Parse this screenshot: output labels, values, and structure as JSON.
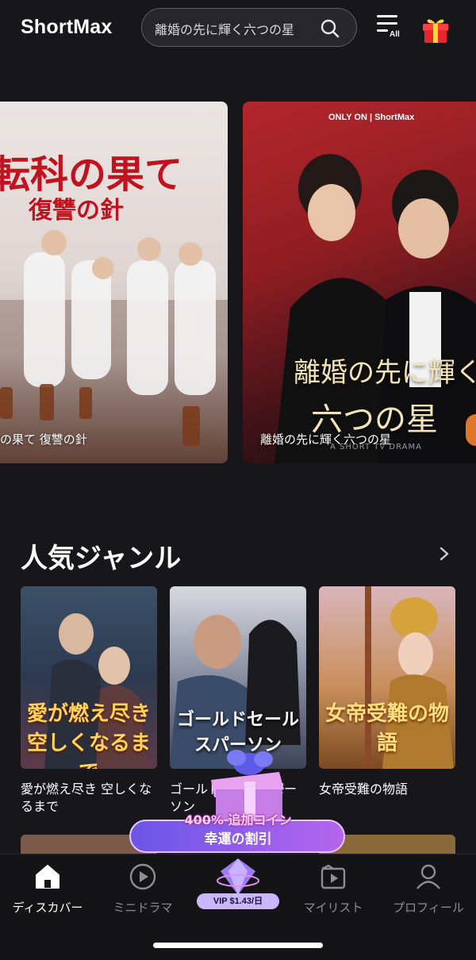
{
  "header": {
    "logo": "ShortMax",
    "search_text": "離婚の先に輝く六つの星",
    "menu_badge": "All"
  },
  "banners": [
    {
      "caption": "の果て 復讐の針",
      "art_title": "転科の果て",
      "art_subtitle": "復讐の針"
    },
    {
      "caption": "離婚の先に輝く六つの星",
      "only_on": "ONLY ON  |  ShortMax",
      "art_title_line1": "離婚の先に輝く",
      "art_title_line2": "六つの星",
      "art_tag": "A SHORT TV DRAMA"
    }
  ],
  "section": {
    "title": "人気ジャンル"
  },
  "cards": [
    {
      "art": "愛が燃え尽き空しくなるまで",
      "label": "愛が燃え尽き 空しくなるまで"
    },
    {
      "art": "ゴールドセールスパーソン",
      "label": "ゴールドセールスパーソン"
    },
    {
      "art": "女帝受難の物語",
      "label": "女帝受難の物語"
    }
  ],
  "promo": {
    "top": "400% 追加コイン",
    "main": "幸運の割引"
  },
  "tabs": [
    {
      "label": "ディスカバー",
      "icon": "home-icon",
      "active": true
    },
    {
      "label": "ミニドラマ",
      "icon": "play-circle-icon",
      "active": false
    },
    {
      "label": "VIP $1.43/日",
      "icon": "vip-gem-icon",
      "active": false
    },
    {
      "label": "マイリスト",
      "icon": "playlist-icon",
      "active": false
    },
    {
      "label": "プロフィール",
      "icon": "person-icon",
      "active": false
    }
  ],
  "colors": {
    "background": "#17171b",
    "accent_orange": "#e0762c",
    "promo_purple": "#8a5ce8"
  }
}
